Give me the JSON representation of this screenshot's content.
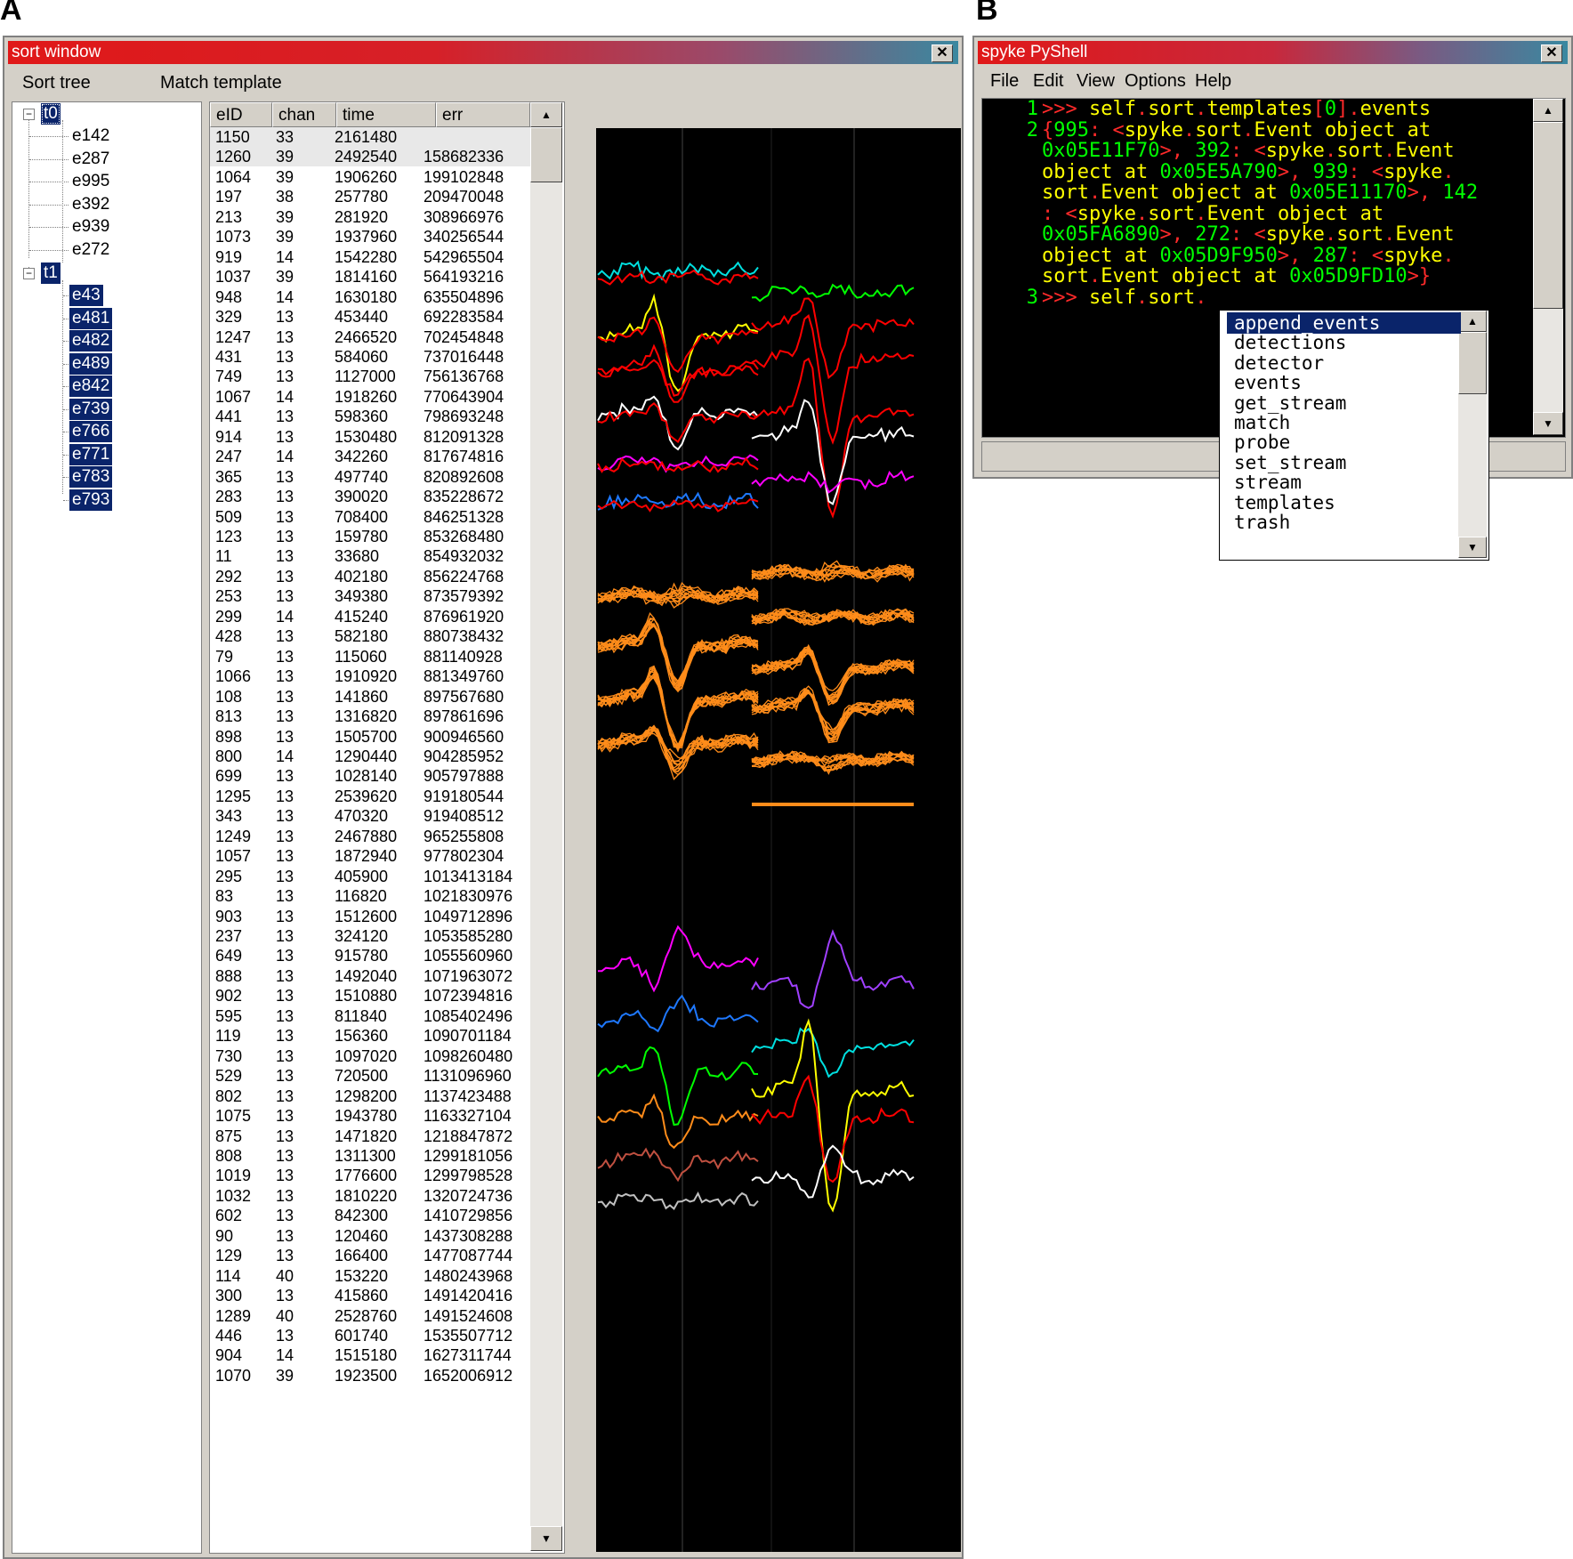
{
  "panels": {
    "a": "A",
    "b": "B"
  },
  "sort_window": {
    "title": "sort window",
    "close": "✕",
    "tabs": [
      "Sort tree",
      "Match template"
    ],
    "tree": {
      "t0": {
        "label": "t0",
        "children": [
          "e142",
          "e287",
          "e995",
          "e392",
          "e939",
          "e272"
        ]
      },
      "t1": {
        "label": "t1",
        "children": [
          "e43",
          "e481",
          "e482",
          "e489",
          "e842",
          "e739",
          "e766",
          "e771",
          "e783",
          "e793"
        ]
      }
    },
    "columns": [
      "eID",
      "chan",
      "time",
      "err"
    ],
    "rows": [
      [
        "1150",
        "33",
        "2161480",
        ""
      ],
      [
        "1260",
        "39",
        "2492540",
        "158682336"
      ],
      [
        "1064",
        "39",
        "1906260",
        "199102848"
      ],
      [
        "197",
        "38",
        "257780",
        "209470048"
      ],
      [
        "213",
        "39",
        "281920",
        "308966976"
      ],
      [
        "1073",
        "39",
        "1937960",
        "340256544"
      ],
      [
        "919",
        "14",
        "1542280",
        "542965504"
      ],
      [
        "1037",
        "39",
        "1814160",
        "564193216"
      ],
      [
        "948",
        "14",
        "1630180",
        "635504896"
      ],
      [
        "329",
        "13",
        "453440",
        "692283584"
      ],
      [
        "1247",
        "13",
        "2466520",
        "702454848"
      ],
      [
        "431",
        "13",
        "584060",
        "737016448"
      ],
      [
        "749",
        "13",
        "1127000",
        "756136768"
      ],
      [
        "1067",
        "14",
        "1918260",
        "770643904"
      ],
      [
        "441",
        "13",
        "598360",
        "798693248"
      ],
      [
        "914",
        "13",
        "1530480",
        "812091328"
      ],
      [
        "247",
        "14",
        "342260",
        "817674816"
      ],
      [
        "365",
        "13",
        "497740",
        "820892608"
      ],
      [
        "283",
        "13",
        "390020",
        "835228672"
      ],
      [
        "509",
        "13",
        "708400",
        "846251328"
      ],
      [
        "123",
        "13",
        "159780",
        "853268480"
      ],
      [
        "11",
        "13",
        "33680",
        "854932032"
      ],
      [
        "292",
        "13",
        "402180",
        "856224768"
      ],
      [
        "253",
        "13",
        "349380",
        "873579392"
      ],
      [
        "299",
        "14",
        "415240",
        "876961920"
      ],
      [
        "428",
        "13",
        "582180",
        "880738432"
      ],
      [
        "79",
        "13",
        "115060",
        "881140928"
      ],
      [
        "1066",
        "13",
        "1910920",
        "881349760"
      ],
      [
        "108",
        "13",
        "141860",
        "897567680"
      ],
      [
        "813",
        "13",
        "1316820",
        "897861696"
      ],
      [
        "898",
        "13",
        "1505700",
        "900946560"
      ],
      [
        "800",
        "14",
        "1290440",
        "904285952"
      ],
      [
        "699",
        "13",
        "1028140",
        "905797888"
      ],
      [
        "1295",
        "13",
        "2539620",
        "919180544"
      ],
      [
        "343",
        "13",
        "470320",
        "919408512"
      ],
      [
        "1249",
        "13",
        "2467880",
        "965255808"
      ],
      [
        "1057",
        "13",
        "1872940",
        "977802304"
      ],
      [
        "295",
        "13",
        "405900",
        "1013413184"
      ],
      [
        "83",
        "13",
        "116820",
        "1021830976"
      ],
      [
        "903",
        "13",
        "1512600",
        "1049712896"
      ],
      [
        "237",
        "13",
        "324120",
        "1053585280"
      ],
      [
        "649",
        "13",
        "915780",
        "1055560960"
      ],
      [
        "888",
        "13",
        "1492040",
        "1071963072"
      ],
      [
        "902",
        "13",
        "1510880",
        "1072394816"
      ],
      [
        "595",
        "13",
        "811840",
        "1085402496"
      ],
      [
        "119",
        "13",
        "156360",
        "1090701184"
      ],
      [
        "730",
        "13",
        "1097020",
        "1098260480"
      ],
      [
        "529",
        "13",
        "720500",
        "1131096960"
      ],
      [
        "802",
        "13",
        "1298200",
        "1137423488"
      ],
      [
        "1075",
        "13",
        "1943780",
        "1163327104"
      ],
      [
        "875",
        "13",
        "1471820",
        "1218847872"
      ],
      [
        "808",
        "13",
        "1311300",
        "1299181056"
      ],
      [
        "1019",
        "13",
        "1776600",
        "1299798528"
      ],
      [
        "1032",
        "13",
        "1810220",
        "1320724736"
      ],
      [
        "602",
        "13",
        "842300",
        "1410729856"
      ],
      [
        "90",
        "13",
        "120460",
        "1437308288"
      ],
      [
        "129",
        "13",
        "166400",
        "1477087744"
      ],
      [
        "114",
        "40",
        "153220",
        "1480243968"
      ],
      [
        "300",
        "13",
        "415860",
        "1491420416"
      ],
      [
        "1289",
        "40",
        "2528760",
        "1491524608"
      ],
      [
        "446",
        "13",
        "601740",
        "1535507712"
      ],
      [
        "904",
        "14",
        "1515180",
        "1627311744"
      ],
      [
        "1070",
        "39",
        "1923500",
        "1652006912"
      ]
    ],
    "highlighted_rows": 2,
    "scroll_up": "▲",
    "scroll_down": "▼"
  },
  "pyshell": {
    "title": "spyke PyShell",
    "close": "✕",
    "menu": [
      "File",
      "Edit",
      "View",
      "Options",
      "Help"
    ],
    "lines": [
      {
        "n": "1",
        "segs": [
          [
            "p",
            ">>> "
          ],
          [
            "y",
            "self"
          ],
          [
            "r",
            "."
          ],
          [
            "y",
            "sort"
          ],
          [
            "r",
            "."
          ],
          [
            "y",
            "templates"
          ],
          [
            "r",
            "["
          ],
          [
            "g",
            "0"
          ],
          [
            "r",
            "]."
          ],
          [
            "y",
            "events"
          ]
        ]
      },
      {
        "n": "2",
        "segs": [
          [
            "r",
            "{"
          ],
          [
            "g",
            "995"
          ],
          [
            "r",
            ": <"
          ],
          [
            "y",
            "spyke"
          ],
          [
            "r",
            "."
          ],
          [
            "y",
            "sort"
          ],
          [
            "r",
            "."
          ],
          [
            "y",
            "Event object at"
          ]
        ]
      },
      {
        "n": "",
        "segs": [
          [
            "g",
            "0x05E11F70"
          ],
          [
            "r",
            ">, "
          ],
          [
            "g",
            "392"
          ],
          [
            "r",
            ": <"
          ],
          [
            "y",
            "spyke"
          ],
          [
            "r",
            "."
          ],
          [
            "y",
            "sort"
          ],
          [
            "r",
            "."
          ],
          [
            "y",
            "Event"
          ]
        ]
      },
      {
        "n": "",
        "segs": [
          [
            "y",
            "object at "
          ],
          [
            "g",
            "0x05E5A790"
          ],
          [
            "r",
            ">, "
          ],
          [
            "g",
            "939"
          ],
          [
            "r",
            ": <"
          ],
          [
            "y",
            "spyke"
          ],
          [
            "r",
            "."
          ]
        ]
      },
      {
        "n": "",
        "segs": [
          [
            "y",
            "sort"
          ],
          [
            "r",
            "."
          ],
          [
            "y",
            "Event object at "
          ],
          [
            "g",
            "0x05E11170"
          ],
          [
            "r",
            ">, "
          ],
          [
            "g",
            "142"
          ]
        ]
      },
      {
        "n": "",
        "segs": [
          [
            "r",
            ": <"
          ],
          [
            "y",
            "spyke"
          ],
          [
            "r",
            "."
          ],
          [
            "y",
            "sort"
          ],
          [
            "r",
            "."
          ],
          [
            "y",
            "Event object at"
          ]
        ]
      },
      {
        "n": "",
        "segs": [
          [
            "g",
            "0x05FA6890"
          ],
          [
            "r",
            ">, "
          ],
          [
            "g",
            "272"
          ],
          [
            "r",
            ": <"
          ],
          [
            "y",
            "spyke"
          ],
          [
            "r",
            "."
          ],
          [
            "y",
            "sort"
          ],
          [
            "r",
            "."
          ],
          [
            "y",
            "Event"
          ]
        ]
      },
      {
        "n": "",
        "segs": [
          [
            "y",
            "object at "
          ],
          [
            "g",
            "0x05D9F950"
          ],
          [
            "r",
            ">, "
          ],
          [
            "g",
            "287"
          ],
          [
            "r",
            ": <"
          ],
          [
            "y",
            "spyke"
          ],
          [
            "r",
            "."
          ]
        ]
      },
      {
        "n": "",
        "segs": [
          [
            "y",
            "sort"
          ],
          [
            "r",
            "."
          ],
          [
            "y",
            "Event object at "
          ],
          [
            "g",
            "0x05D9FD10"
          ],
          [
            "r",
            ">}"
          ]
        ]
      },
      {
        "n": "3",
        "segs": [
          [
            "p",
            ">>> "
          ],
          [
            "y",
            "self"
          ],
          [
            "r",
            "."
          ],
          [
            "y",
            "sort"
          ],
          [
            "r",
            "."
          ]
        ]
      }
    ],
    "autocomplete": [
      "append_events",
      "detections",
      "detector",
      "events",
      "get_stream",
      "match",
      "probe",
      "set_stream",
      "stream",
      "templates",
      "trash"
    ]
  },
  "colors": {
    "selection": "#0a246a",
    "waveform_palette": [
      "#00e0e0",
      "#ff0000",
      "#00ff00",
      "#ffff00",
      "#ffffff",
      "#ff00ff",
      "#1e78ff",
      "#ff8c1a",
      "#a040ff",
      "#c05040",
      "#c0c0c0"
    ]
  }
}
